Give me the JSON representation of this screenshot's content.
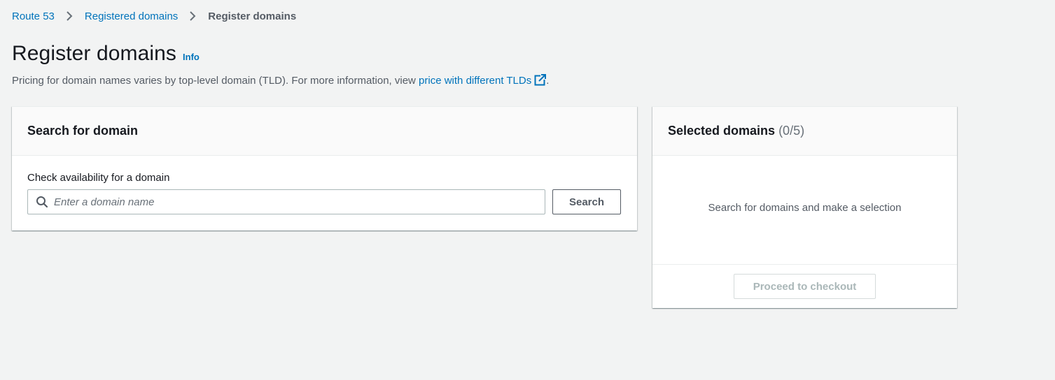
{
  "breadcrumb": {
    "items": [
      "Route 53",
      "Registered domains"
    ],
    "current": "Register domains"
  },
  "header": {
    "title": "Register domains",
    "info_label": "Info",
    "description_prefix": "Pricing for domain names varies by top-level domain (TLD). For more information, view ",
    "description_link": "price with different TLDs",
    "description_suffix": "."
  },
  "search_panel": {
    "title": "Search for domain",
    "field_label": "Check availability for a domain",
    "input_placeholder": "Enter a domain name",
    "input_value": "",
    "search_button": "Search"
  },
  "selected_panel": {
    "title": "Selected domains",
    "count": "(0/5)",
    "empty_message": "Search for domains and make a selection",
    "checkout_button": "Proceed to checkout"
  },
  "colors": {
    "link": "#0073bb",
    "background": "#f2f3f3",
    "text": "#16191f",
    "muted": "#545b64",
    "disabled": "#aab7b8"
  },
  "icons": [
    "chevron-right-icon",
    "external-link-icon",
    "search-icon"
  ]
}
